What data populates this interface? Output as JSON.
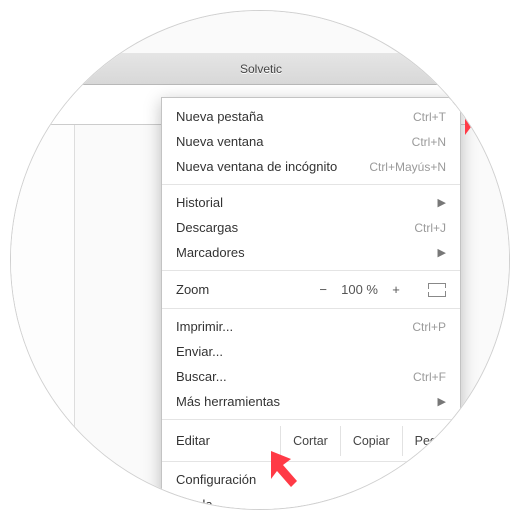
{
  "window": {
    "title": "Solvetic"
  },
  "menu": {
    "new_tab": {
      "label": "Nueva pestaña",
      "shortcut": "Ctrl+T"
    },
    "new_window": {
      "label": "Nueva ventana",
      "shortcut": "Ctrl+N"
    },
    "new_incognito": {
      "label": "Nueva ventana de incógnito",
      "shortcut": "Ctrl+Mayús+N"
    },
    "history": {
      "label": "Historial"
    },
    "downloads": {
      "label": "Descargas",
      "shortcut": "Ctrl+J"
    },
    "bookmarks": {
      "label": "Marcadores"
    },
    "zoom": {
      "label": "Zoom",
      "minus": "−",
      "value": "100 %",
      "plus": "+"
    },
    "print": {
      "label": "Imprimir...",
      "shortcut": "Ctrl+P"
    },
    "cast": {
      "label": "Enviar..."
    },
    "find": {
      "label": "Buscar...",
      "shortcut": "Ctrl+F"
    },
    "more_tools": {
      "label": "Más herramientas"
    },
    "edit": {
      "label": "Editar",
      "cut": "Cortar",
      "copy": "Copiar",
      "paste": "Pegar"
    },
    "settings": {
      "label": "Configuración"
    },
    "help": {
      "label": "Ayuda"
    }
  }
}
